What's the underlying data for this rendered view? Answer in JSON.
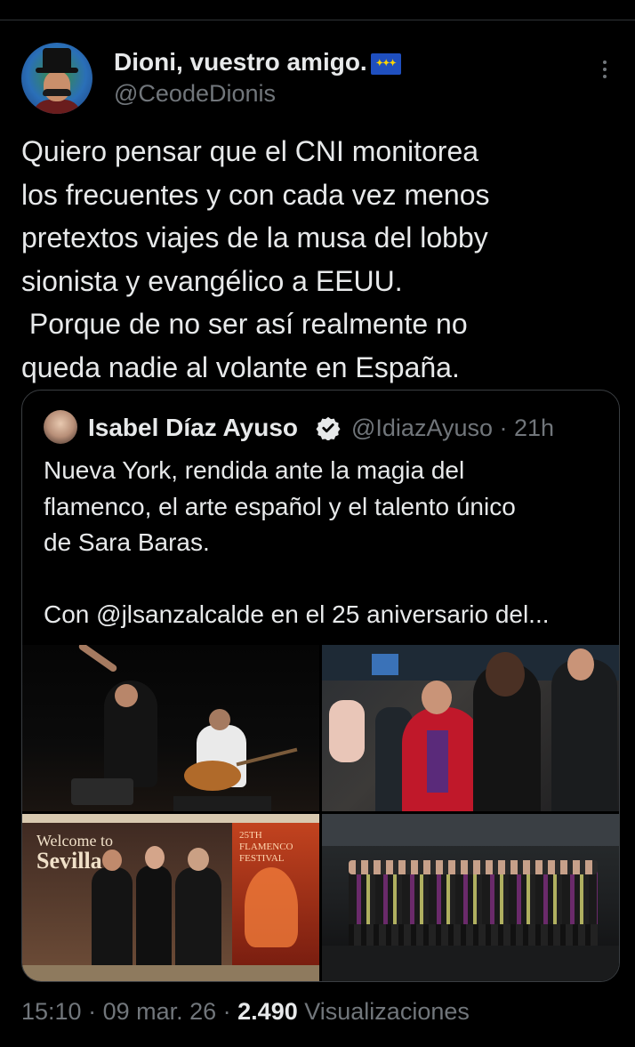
{
  "author": {
    "name": "Dioni, vuestro amigo.",
    "handle": "@CeodeDionis",
    "flag_icon": "eu-flag-icon"
  },
  "more_icon": "more-vertical-icon",
  "tweet": {
    "text": "Quiero pensar que el CNI monitorea\nlos frecuentes y con cada vez menos\npretextos viajes de la musa del lobby\nsionista y evangélico a EEUU.\n Porque de no ser así realmente no\nqueda nadie al volante en España."
  },
  "quoted": {
    "name": "Isabel Díaz Ayuso",
    "verified_icon": "verified-badge-icon",
    "handle_time": "@IdiazAyuso · 21h",
    "text": "Nueva York, rendida ante la magia del\nflamenco, el arte español y el talento único\nde Sara Baras.\n\nCon @jlsanzalcalde en el 25 aniversario del...",
    "photos": [
      {
        "label": "flamenco-dancer-guitarist-photo"
      },
      {
        "label": "woman-red-shawl-crowd-photo"
      },
      {
        "label": "welcome-to-sevilla-photo",
        "sign_line1": "Welcome to",
        "sign_line2": "Sevilla",
        "poster": "25TH\nFLAMENCO\nFESTIVAL"
      },
      {
        "label": "stage-group-photo"
      }
    ]
  },
  "meta": {
    "time": "15:10",
    "date": "09 mar. 26",
    "views_count": "2.490",
    "views_label": "Visualizaciones"
  },
  "colors": {
    "background": "#000000",
    "text": "#e7e9ea",
    "secondary": "#71767b",
    "border": "#3a3e42",
    "verified": "#e7e9ea"
  }
}
